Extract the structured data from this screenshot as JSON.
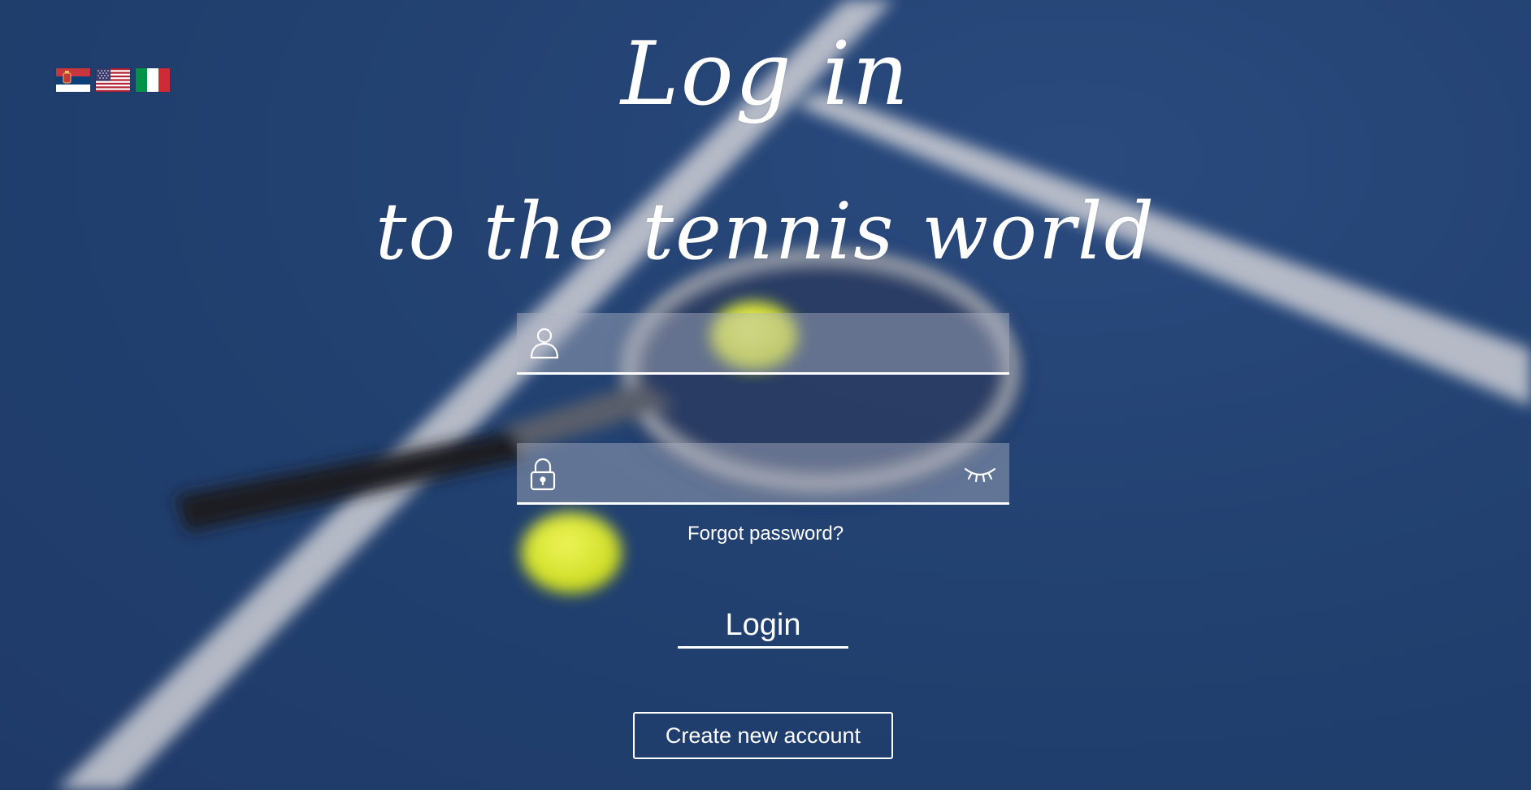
{
  "page": {
    "title_line1": "Log in",
    "title_line2": "to the tennis world"
  },
  "languages": [
    {
      "name": "Serbian",
      "icon": "serbia-flag-icon"
    },
    {
      "name": "English",
      "icon": "usa-flag-icon"
    },
    {
      "name": "Italian",
      "icon": "italy-flag-icon"
    }
  ],
  "form": {
    "username": {
      "value": "",
      "placeholder": "",
      "icon": "user-icon"
    },
    "password": {
      "value": "",
      "placeholder": "",
      "icon": "lock-icon",
      "toggle_icon": "eye-closed-icon"
    },
    "forgot_password": "Forgot password?",
    "login_label": "Login",
    "create_account_label": "Create new account"
  },
  "colors": {
    "background": "#26457a",
    "text": "#ffffff",
    "field_fill": "#aeb4c3",
    "ball": "#d9e823"
  }
}
